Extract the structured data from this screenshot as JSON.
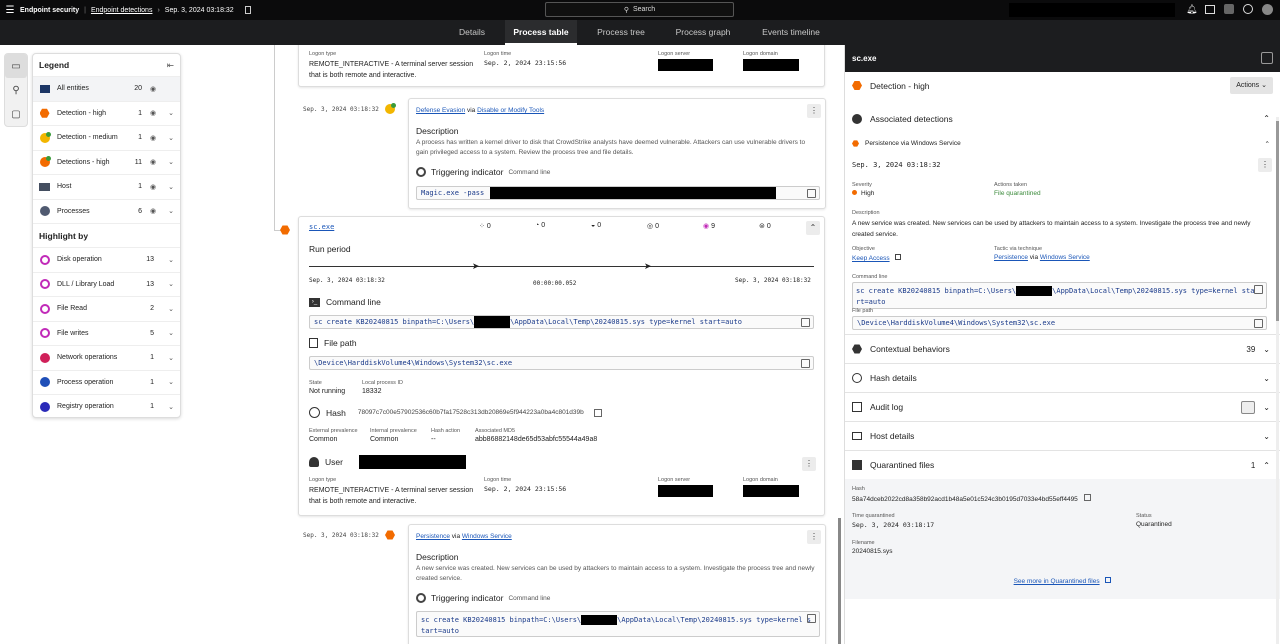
{
  "topbar": {
    "product": "Endpoint security",
    "breadcrumb_link": "Endpoint detections",
    "breadcrumb_date": "Sep. 3, 2024 03:18:32",
    "search_label": "Search"
  },
  "tabs": [
    "Details",
    "Process table",
    "Process tree",
    "Process graph",
    "Events timeline"
  ],
  "legend": {
    "title": "Legend",
    "entities": [
      {
        "label": "All entities",
        "count": "20"
      },
      {
        "label": "Detection - high",
        "count": "1"
      },
      {
        "label": "Detection - medium",
        "count": "1"
      },
      {
        "label": "Detections - high",
        "count": "11"
      },
      {
        "label": "Host",
        "count": "1"
      },
      {
        "label": "Processes",
        "count": "6"
      }
    ],
    "highlight_title": "Highlight by",
    "highlights": [
      {
        "label": "Disk operation",
        "count": "13"
      },
      {
        "label": "DLL / Library Load",
        "count": "13"
      },
      {
        "label": "File Read",
        "count": "2"
      },
      {
        "label": "File writes",
        "count": "5"
      },
      {
        "label": "Network operations",
        "count": "1"
      },
      {
        "label": "Process operation",
        "count": "1"
      },
      {
        "label": "Registry operation",
        "count": "1"
      }
    ]
  },
  "top_logon": {
    "type_k": "Logon type",
    "type_v": "REMOTE_INTERACTIVE - A terminal server session that is both remote and interactive.",
    "time_k": "Logon time",
    "time_v": "Sep. 2, 2024 23:15:56",
    "server_k": "Logon server",
    "domain_k": "Logon domain"
  },
  "det1": {
    "ts": "Sep. 3, 2024 03:18:32",
    "tactic": "Defense Evasion",
    "via": "via",
    "technique": "Disable or Modify Tools",
    "desc_title": "Description",
    "desc": "A process has written a kernel driver to disk that CrowdStrike analysts have deemed vulnerable. Attackers can use vulnerable drivers to gain privileged access to a system. Review the process tree and file details.",
    "trig_title": "Triggering indicator",
    "trig_sub": "Command line",
    "cmd": "Magic.exe -pass"
  },
  "proc": {
    "name": "sc.exe",
    "counts": [
      "0",
      "0",
      "0",
      "0",
      "9",
      "0"
    ],
    "run_title": "Run period",
    "start": "Sep. 3, 2024 03:18:32",
    "duration": "00:00:00.052",
    "end": "Sep. 3, 2024 03:18:32",
    "cmd_title": "Command line",
    "cmd_a": "sc create KB20240815 binpath=C:\\Users\\",
    "cmd_b": "\\AppData\\Local\\Temp\\20240815.sys type=kernel start=auto",
    "path_title": "File path",
    "path": "\\Device\\HarddiskVolume4\\Windows\\System32\\sc.exe",
    "state_k": "State",
    "state_v": "Not running",
    "pid_k": "Local process ID",
    "pid_v": "18332",
    "hash_title": "Hash",
    "hash": "78097c7c00e57902536c60b7fa17528c313db20869e5f944223a0ba4c801d39b",
    "ext_k": "External prevalence",
    "ext_v": "Common",
    "int_k": "Internal prevalence",
    "int_v": "Common",
    "ha_k": "Hash action",
    "ha_v": "--",
    "md5_k": "Associated MD5",
    "md5_v": "abb86882148de65d53abfc55544a49a8",
    "user_title": "User",
    "logon_type_k": "Logon type",
    "logon_type_v": "REMOTE_INTERACTIVE - A terminal server session that is both remote and interactive.",
    "logon_time_k": "Logon time",
    "logon_time_v": "Sep. 2, 2024 23:15:56",
    "logon_server_k": "Logon server",
    "logon_domain_k": "Logon domain"
  },
  "det2": {
    "ts": "Sep. 3, 2024 03:18:32",
    "tactic": "Persistence",
    "via": "via",
    "technique": "Windows Service",
    "desc_title": "Description",
    "desc": "A new service was created. New services can be used by attackers to maintain access to a system. Investigate the process tree and newly created service.",
    "trig_title": "Triggering indicator",
    "trig_sub": "Command line",
    "cmd_a": "sc create KB20240815 binpath=C:\\Users\\",
    "cmd_b": "\\AppData\\Local\\Temp\\20240815.sys type=kernel s",
    "cmd_c": "tart=auto"
  },
  "panel": {
    "title": "sc.exe",
    "detection": "Detection - high",
    "actions": "Actions",
    "assoc": "Associated detections",
    "assoc_item": "Persistence via Windows Service",
    "ts": "Sep. 3, 2024 03:18:32",
    "sev_k": "Severity",
    "sev_v": "High",
    "act_k": "Actions taken",
    "act_v": "File quarantined",
    "desc_k": "Description",
    "desc_v": "A new service was created. New services can be used by attackers to maintain access to a system. Investigate the process tree and newly created service.",
    "obj_k": "Objective",
    "obj_v": "Keep Access",
    "tac_k": "Tactic via technique",
    "tac_v": "Persistence",
    "via": "via",
    "tech_v": "Windows Service",
    "cmd_k": "Command line",
    "cmd_a": "sc create KB20240815 binpath=C:\\Users\\",
    "cmd_b": "\\AppData\\Local\\Temp\\20240815.sys type=kernel sta",
    "cmd_c": "rt=auto",
    "fp_k": "File path",
    "fp_v": "\\Device\\HarddiskVolume4\\Windows\\System32\\sc.exe",
    "ctx": "Contextual behaviors",
    "ctx_count": "39",
    "hashd": "Hash details",
    "audit": "Audit log",
    "hostd": "Host details",
    "quar": "Quarantined files",
    "quar_count": "1",
    "qhash_k": "Hash",
    "qhash_v": "58a74dceb2022cd8a358b92acd1b48a5e01c524c3b0195d7033e4bd55eff4495",
    "qtime_k": "Time quarantined",
    "qtime_v": "Sep. 3, 2024 03:18:17",
    "qstat_k": "Status",
    "qstat_v": "Quarantined",
    "qfn_k": "Filename",
    "qfn_v": "20240815.sys",
    "seemore": "See more in Quarantined files"
  },
  "colors": {
    "accent_orange": "#f26b00",
    "accent_magenta": "#c12ab8",
    "link": "#1a56b8"
  }
}
